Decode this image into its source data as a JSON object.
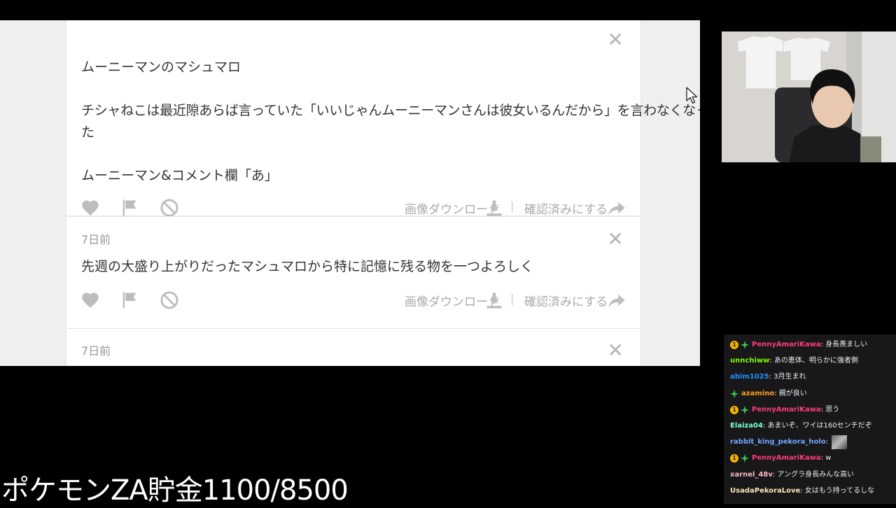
{
  "page": {
    "card1": {
      "lines": [
        "ムーニーマンのマシュマロ",
        "",
        "チシャねこは最近隙あらば言っていた「いいじゃんムーニーマンさんは彼女いるんだから」を言わなくなっ",
        "た",
        "",
        "ムーニーマン&コメント欄「あ」"
      ]
    },
    "card2": {
      "age": "7日前",
      "text": "先週の大盛り上がりだったマシュマロから特に記憶に残る物を一つよろしく"
    },
    "card3": {
      "age": "7日前"
    },
    "actions": {
      "download_label": "画像ダウンロード",
      "separator": "|",
      "confirm_label": "確認済みにする"
    },
    "close_symbol": "✕"
  },
  "chat": {
    "messages": [
      {
        "user": "PennyAmariKawa",
        "color": "#ff3c78",
        "badges": [
          "sub",
          "star"
        ],
        "text": "身長羨ましい"
      },
      {
        "user": "unnchiww",
        "color": "#7cfc00",
        "badges": [],
        "text": "あの恵体、明らかに強者側"
      },
      {
        "user": "abim1025",
        "color": "#1e90ff",
        "badges": [],
        "text": "3月生まれ"
      },
      {
        "user": "azamino",
        "color": "#ff9f1c",
        "badges": [
          "star"
        ],
        "text": "親が良い"
      },
      {
        "user": "PennyAmariKawa",
        "color": "#ff3c78",
        "badges": [
          "sub",
          "star"
        ],
        "text": "思う"
      },
      {
        "user": "Elaiza04",
        "color": "#7fffd4",
        "badges": [],
        "text": "あまいぞ、ワイは160センチだぞ"
      },
      {
        "user": "rabbit_king_pekora_holo",
        "color": "#6fa8ff",
        "badges": [],
        "text": "",
        "emote": true
      },
      {
        "user": "PennyAmariKawa",
        "color": "#ff3c78",
        "badges": [
          "sub",
          "star"
        ],
        "text": "w"
      },
      {
        "user": "xarnel_48v",
        "color": "#ffb6c1",
        "badges": [],
        "text": "アングラ身長みんな高い"
      },
      {
        "user": "UsadaPekoraLove",
        "color": "#ffe4b5",
        "badges": [],
        "text": "女はもう持ってるしな"
      }
    ]
  },
  "overlay": {
    "text": "ポケモンZA貯金1100/8500"
  },
  "badges": {
    "sub_glyph": "1"
  },
  "colors": {
    "page_bg": "#efefef",
    "card_bg": "#ffffff",
    "icon_gray": "#bdbdbd",
    "chat_bg": "#18181b"
  }
}
